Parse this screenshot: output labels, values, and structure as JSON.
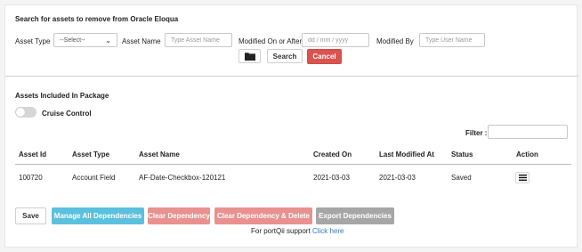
{
  "search": {
    "title": "Search for assets to remove from Oracle Eloqua",
    "asset_type_label": "Asset Type",
    "asset_type_value": "--Select--",
    "asset_name_label": "Asset Name",
    "asset_name_placeholder": "Type Asset Name",
    "modified_label": "Modified On or After",
    "modified_placeholder": "dd / mm / yyyy",
    "modified_by_label": "Modified By",
    "modified_by_placeholder": "Type User Name",
    "search_button": "Search",
    "cancel_button": "Cancel"
  },
  "package": {
    "title": "Assets Included In Package",
    "cruise_control_label": "Cruise Control",
    "cruise_control_on": false,
    "filter_label": "Filter :"
  },
  "table": {
    "columns": [
      "Asset Id",
      "Asset Type",
      "Asset Name",
      "Created On",
      "Last Modified At",
      "Status",
      "Action"
    ],
    "rows": [
      {
        "asset_id": "100720",
        "asset_type": "Account Field",
        "asset_name": "AF-Date-Checkbox-120121",
        "created_on": "2021-03-03",
        "last_modified": "2021-03-03",
        "status": "Saved",
        "action_icon": "hamburger-menu-icon"
      }
    ]
  },
  "actions": {
    "save": "Save",
    "manage_all": "Manage All Dependencies",
    "clear_dependency": "Clear Dependency",
    "clear_delete": "Clear Dependency & Delete",
    "export": "Export Dependencies"
  },
  "support": {
    "text": "For portQii support",
    "link": "Click here"
  },
  "colors": {
    "cancel": "#d9534f",
    "manage": "#5bc0de",
    "clear": "#e8918f",
    "export": "#a6a6a6",
    "link": "#337ab7"
  }
}
